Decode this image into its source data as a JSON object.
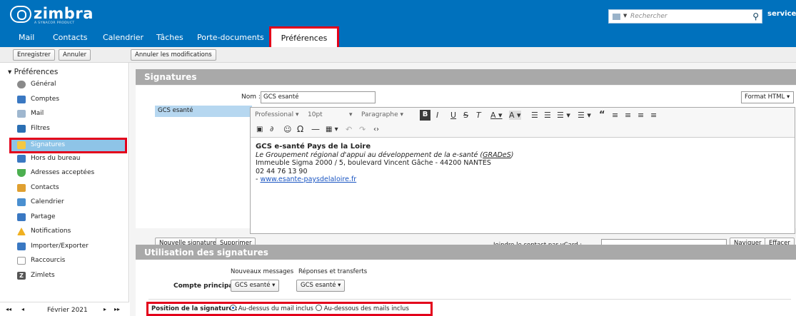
{
  "app": {
    "logo": {
      "word": "zimbra",
      "tagline": "A SYNACOR PRODUCT"
    },
    "search": {
      "placeholder": "Rechercher"
    },
    "user": "service SI"
  },
  "tabs": [
    {
      "label": "Mail"
    },
    {
      "label": "Contacts"
    },
    {
      "label": "Calendrier"
    },
    {
      "label": "Tâches"
    },
    {
      "label": "Porte-documents"
    },
    {
      "label": "Préférences",
      "active": true
    }
  ],
  "toolbar": {
    "save": "Enregistrer",
    "cancel": "Annuler",
    "undo_changes": "Annuler les modifications"
  },
  "sidebar": {
    "title": "Préférences",
    "items": [
      {
        "label": "Général",
        "icon": "gear-icon",
        "color": "#8a8a8a"
      },
      {
        "label": "Comptes",
        "icon": "accounts-icon",
        "color": "#3a78c2"
      },
      {
        "label": "Mail",
        "icon": "mail-icon",
        "color": "#9fb7cf"
      },
      {
        "label": "Filtres",
        "icon": "filter-icon",
        "color": "#2b6fb3"
      },
      {
        "label": "Signatures",
        "icon": "signature-icon",
        "color": "#f5c842",
        "selected": true
      },
      {
        "label": "Hors du bureau",
        "icon": "out-of-office-icon",
        "color": "#3a78c2"
      },
      {
        "label": "Adresses acceptées",
        "icon": "shield-check-icon",
        "color": "#4caf50"
      },
      {
        "label": "Contacts",
        "icon": "contact-icon",
        "color": "#e0a030"
      },
      {
        "label": "Calendrier",
        "icon": "calendar-icon",
        "color": "#4a8fd0"
      },
      {
        "label": "Partage",
        "icon": "share-icon",
        "color": "#3a78c2"
      },
      {
        "label": "Notifications",
        "icon": "bell-warning-icon",
        "color": "#f0b020"
      },
      {
        "label": "Importer/Exporter",
        "icon": "import-export-icon",
        "color": "#3a78c2"
      },
      {
        "label": "Raccourcis",
        "icon": "keyboard-icon",
        "color": "#a8a8a8"
      },
      {
        "label": "Zimlets",
        "icon": "zimlet-icon",
        "color": "#555555"
      }
    ],
    "calendar": {
      "month": "Février 2021"
    }
  },
  "signatures": {
    "header": "Signatures",
    "list": [
      "GCS esanté"
    ],
    "name_label": "Nom :",
    "name_value": "GCS esanté",
    "format": "Format HTML",
    "editor": {
      "font": "Professional",
      "size": "10pt",
      "block": "Paragraphe"
    },
    "body": {
      "line1": "GCS e-santé Pays de la Loire",
      "line2_a": "Le Groupement régional d'appui au développement de la e-santé (",
      "line2_abbr": "GRADeS",
      "line2_b": ")",
      "line3": "Immeuble Sigma 2000 / 5, boulevard Vincent Gâche - 44200 NANTES",
      "line4": "02 44 76 13 90",
      "line5_dash": "- ",
      "line5_link": "www.esante-paysdelaloire.fr"
    },
    "new_button": "Nouvelle signature",
    "delete_button": "Supprimer",
    "vcard_label": "Joindre le contact par vCard :",
    "browse_button": "Naviguer",
    "clear_button": "Effacer"
  },
  "usage": {
    "header": "Utilisation des signatures",
    "col_new": "Nouveaux messages",
    "col_reply": "Réponses et transferts",
    "account_label": "Compte principal:",
    "new_value": "GCS esanté",
    "reply_value": "GCS esanté",
    "position_label": "Position de la signature :",
    "position_options": [
      {
        "label": "Au-dessus du mail inclus",
        "checked": true
      },
      {
        "label": "Au-dessous des mails inclus",
        "checked": false
      }
    ]
  },
  "colors": {
    "brand": "#0071bd",
    "highlight": "#e3001b",
    "selection": "#8ec4e7"
  }
}
